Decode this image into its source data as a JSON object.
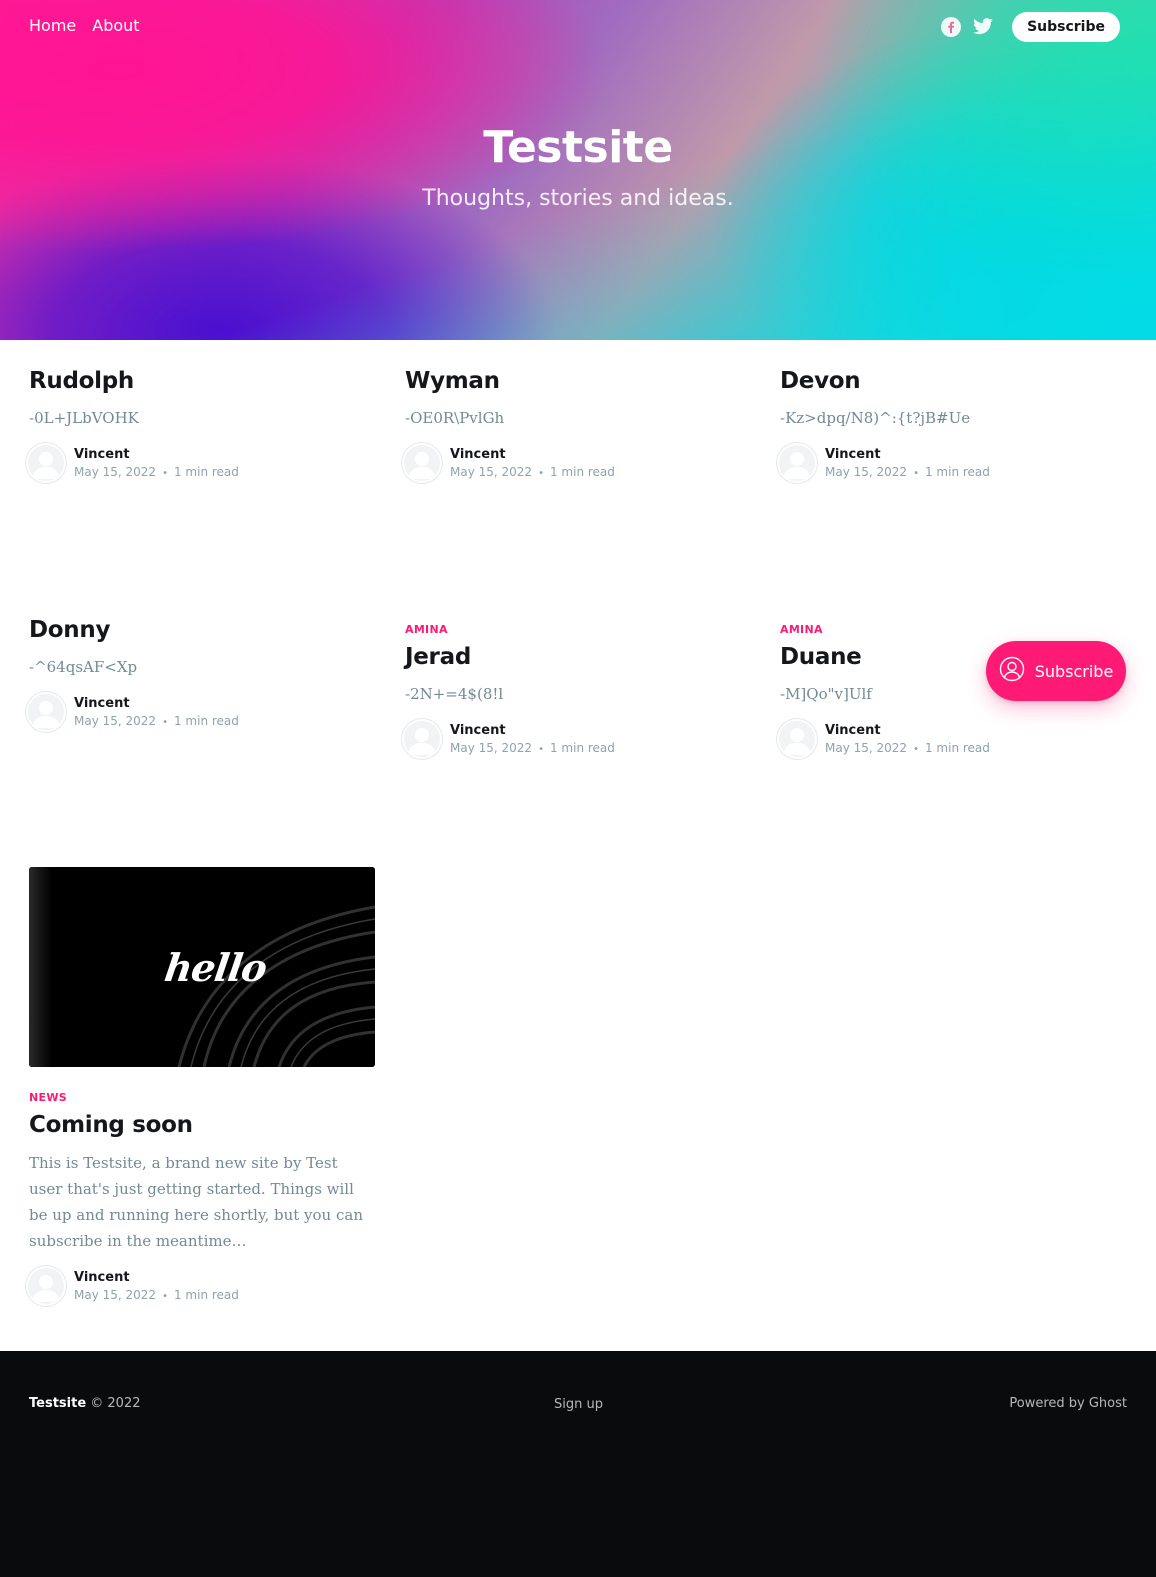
{
  "nav": {
    "links": [
      "Home",
      "About"
    ],
    "social": [
      "facebook-icon",
      "twitter-icon"
    ],
    "subscribe_label": "Subscribe"
  },
  "hero": {
    "title": "Testsite",
    "subtitle": "Thoughts, stories and ideas."
  },
  "posts": [
    {
      "tag": "",
      "title": "Rudolph",
      "excerpt": "-0L+JLbVOHK",
      "author": "Vincent",
      "date": "May 15, 2022",
      "read_time": "1 min read"
    },
    {
      "tag": "",
      "title": "Wyman",
      "excerpt": "-OE0R\\PvlGh",
      "author": "Vincent",
      "date": "May 15, 2022",
      "read_time": "1 min read"
    },
    {
      "tag": "",
      "title": "Devon",
      "excerpt": "-Kz>dpq/N8)^:{t?jB#Ue",
      "author": "Vincent",
      "date": "May 15, 2022",
      "read_time": "1 min read"
    },
    {
      "tag": "",
      "title": "Donny",
      "excerpt": "-^64qsAF<Xp",
      "author": "Vincent",
      "date": "May 15, 2022",
      "read_time": "1 min read"
    },
    {
      "tag": "Amina",
      "title": "Jerad",
      "excerpt": "-2N+=4$(8!l",
      "author": "Vincent",
      "date": "May 15, 2022",
      "read_time": "1 min read"
    },
    {
      "tag": "Amina",
      "title": "Duane",
      "excerpt": "-M]Qo\"v]Ulf",
      "author": "Vincent",
      "date": "May 15, 2022",
      "read_time": "1 min read"
    },
    {
      "tag": "News",
      "title": "Coming soon",
      "excerpt": "This is Testsite, a brand new site by Test user that's just getting started. Things will be up and running here shortly, but you can subscribe in the meantime…",
      "author": "Vincent",
      "date": "May 15, 2022",
      "read_time": "1 min read",
      "image_text": "hello"
    }
  ],
  "floating_subscribe": {
    "label": "Subscribe"
  },
  "footer": {
    "site_name": "Testsite",
    "copyright": "© 2022",
    "signup": "Sign up",
    "powered": "Powered by Ghost"
  },
  "colors": {
    "accent": "#ff1a75",
    "footer_bg": "#0a0b0c",
    "excerpt": "#738a94",
    "meta": "#90a2aa"
  }
}
